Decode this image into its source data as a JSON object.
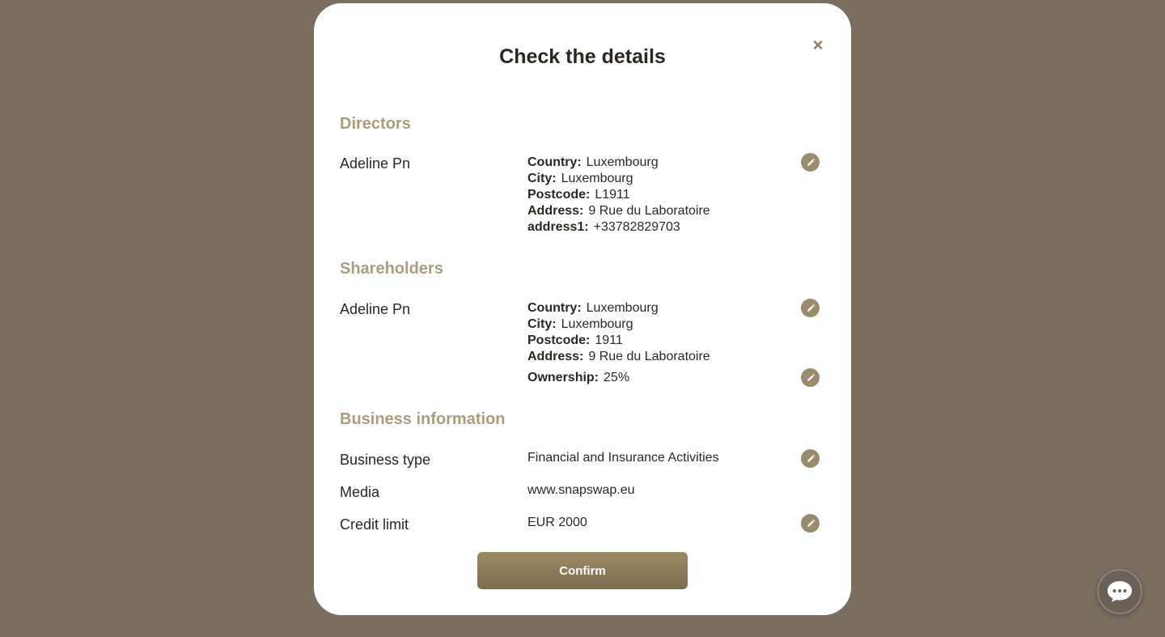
{
  "modal": {
    "title": "Check the details",
    "close_icon": "×"
  },
  "directors": {
    "section_title": "Directors",
    "items": [
      {
        "name": "Adeline Pn",
        "fields": [
          {
            "label": "Country:",
            "value": "Luxembourg"
          },
          {
            "label": "City:",
            "value": "Luxembourg"
          },
          {
            "label": "Postcode:",
            "value": "L1911"
          },
          {
            "label": "Address:",
            "value": "9 Rue du Laboratoire"
          },
          {
            "label": "address1:",
            "value": "+33782829703"
          }
        ]
      }
    ]
  },
  "shareholders": {
    "section_title": "Shareholders",
    "items": [
      {
        "name": "Adeline Pn",
        "fields": [
          {
            "label": "Country:",
            "value": "Luxembourg"
          },
          {
            "label": "City:",
            "value": "Luxembourg"
          },
          {
            "label": "Postcode:",
            "value": "1911"
          },
          {
            "label": "Address:",
            "value": "9 Rue du Laboratoire"
          }
        ],
        "ownership": {
          "label": "Ownership:",
          "value": "25%"
        }
      }
    ]
  },
  "business": {
    "section_title": "Business information",
    "rows": [
      {
        "label": "Business type",
        "value": "Financial and Insurance Activities"
      },
      {
        "label": "Media",
        "value": "www.snapswap.eu"
      },
      {
        "label": "Credit limit",
        "value": "EUR 2000"
      }
    ]
  },
  "confirm_label": "Confirm",
  "icons": {
    "edit": "pencil-icon",
    "close": "close-icon",
    "chat": "chat-bubble-icon"
  },
  "colors": {
    "backdrop": "#796e5f",
    "accent": "#9a8b6d",
    "section_title": "#ab9c7c"
  }
}
